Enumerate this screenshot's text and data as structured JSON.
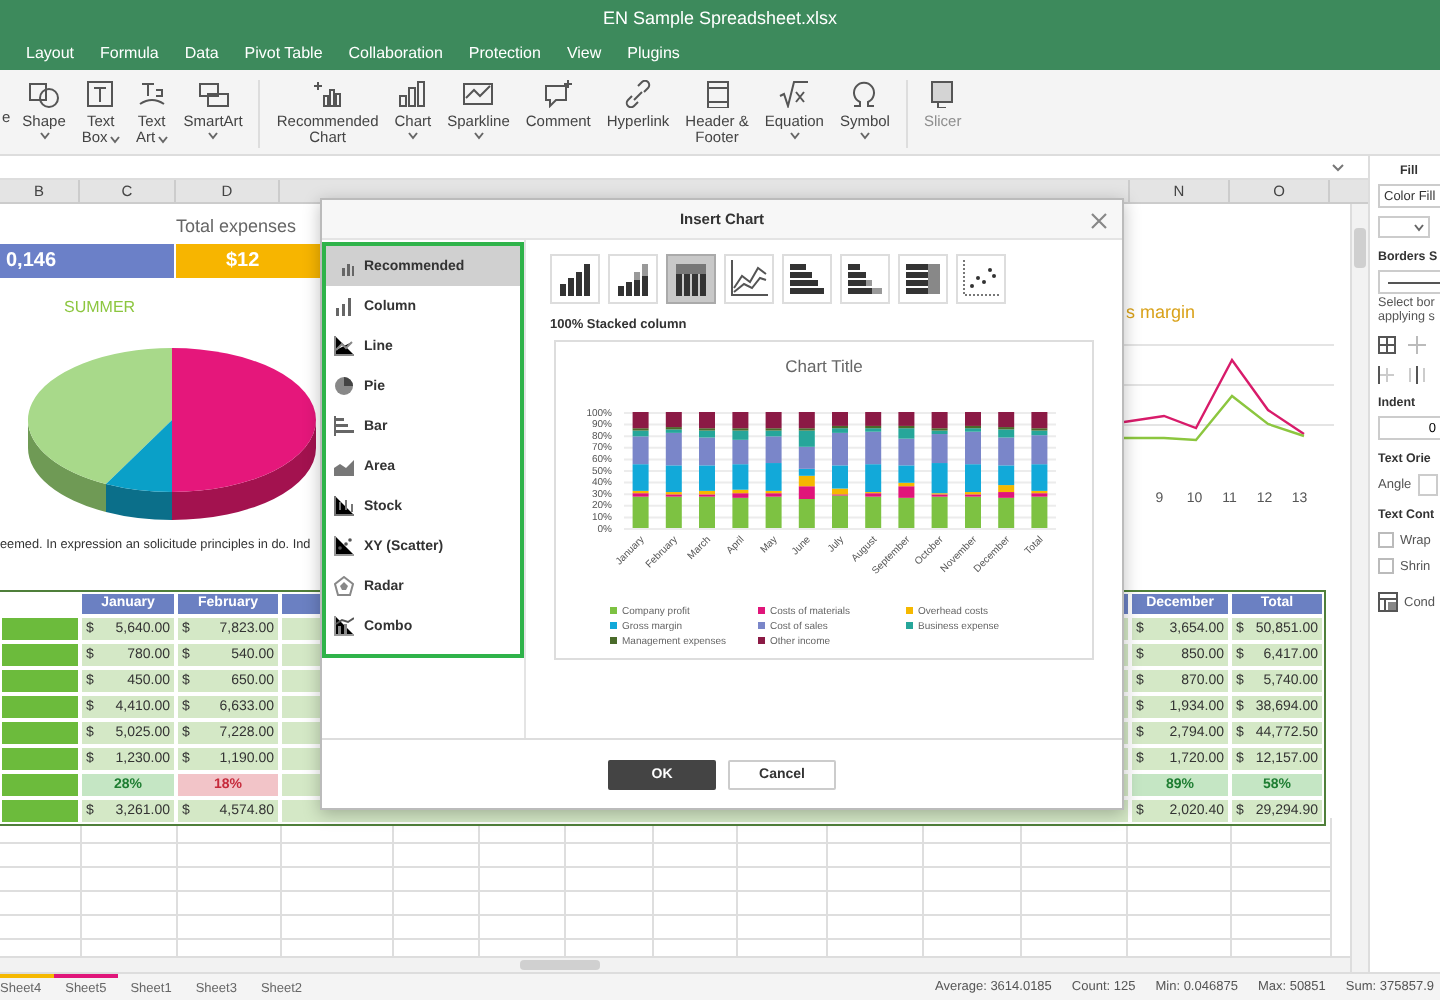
{
  "window": {
    "title": "EN Sample Spreadsheet.xlsx"
  },
  "menu_tabs": [
    {
      "label": "Layout"
    },
    {
      "label": "Formula"
    },
    {
      "label": "Data"
    },
    {
      "label": "Pivot Table"
    },
    {
      "label": "Collaboration"
    },
    {
      "label": "Protection"
    },
    {
      "label": "View"
    },
    {
      "label": "Plugins"
    }
  ],
  "toolbar": [
    {
      "lines": [
        "e"
      ],
      "dropdown": false,
      "disabled": false
    },
    {
      "lines": [
        "Shape"
      ],
      "dropdown": true,
      "disabled": false
    },
    {
      "lines": [
        "Text",
        "Box"
      ],
      "dropdown": true,
      "disabled": false
    },
    {
      "lines": [
        "Text",
        "Art"
      ],
      "dropdown": true,
      "disabled": false
    },
    {
      "lines": [
        "SmartArt"
      ],
      "dropdown": true,
      "disabled": false
    },
    {
      "lines": [
        "Recommended",
        "Chart"
      ],
      "dropdown": false,
      "disabled": false
    },
    {
      "lines": [
        "Chart"
      ],
      "dropdown": true,
      "disabled": false
    },
    {
      "lines": [
        "Sparkline"
      ],
      "dropdown": true,
      "disabled": false
    },
    {
      "lines": [
        "Comment"
      ],
      "dropdown": false,
      "disabled": false
    },
    {
      "lines": [
        "Hyperlink"
      ],
      "dropdown": false,
      "disabled": false
    },
    {
      "lines": [
        "Header &",
        "Footer"
      ],
      "dropdown": false,
      "disabled": false
    },
    {
      "lines": [
        "Equation"
      ],
      "dropdown": true,
      "disabled": false
    },
    {
      "lines": [
        "Symbol"
      ],
      "dropdown": true,
      "disabled": false
    },
    {
      "lines": [
        "Slicer"
      ],
      "dropdown": false,
      "disabled": true
    }
  ],
  "column_headers": [
    "B",
    "C",
    "D",
    "N",
    "O"
  ],
  "sheet": {
    "banner_title": "Total expenses",
    "totals": [
      {
        "text": "0,146",
        "color": "#6b80c8"
      },
      {
        "text": "$12",
        "color": "#f7b500"
      }
    ],
    "pie_title": "SUMMER",
    "caption": "eemed. In expression an solicitude principles in do. Ind",
    "line_title": "s margin",
    "line_xticks": [
      "9",
      "10",
      "11",
      "12",
      "13"
    ],
    "table": {
      "columns": [
        "January",
        "February",
        "December",
        "Total"
      ],
      "rows": [
        {
          "kind": "money",
          "cells": [
            {
              "symbol": "$",
              "amount": "5,640.00"
            },
            {
              "symbol": "$",
              "amount": "7,823.00"
            },
            {
              "symbol": "$",
              "amount": "3,654.00"
            },
            {
              "symbol": "$",
              "amount": "50,851.00"
            }
          ]
        },
        {
          "kind": "money",
          "cells": [
            {
              "symbol": "$",
              "amount": "780.00"
            },
            {
              "symbol": "$",
              "amount": "540.00"
            },
            {
              "symbol": "$",
              "amount": "850.00"
            },
            {
              "symbol": "$",
              "amount": "6,417.00"
            }
          ]
        },
        {
          "kind": "money",
          "cells": [
            {
              "symbol": "$",
              "amount": "450.00"
            },
            {
              "symbol": "$",
              "amount": "650.00"
            },
            {
              "symbol": "$",
              "amount": "870.00"
            },
            {
              "symbol": "$",
              "amount": "5,740.00"
            }
          ]
        },
        {
          "kind": "money",
          "cells": [
            {
              "symbol": "$",
              "amount": "4,410.00"
            },
            {
              "symbol": "$",
              "amount": "6,633.00"
            },
            {
              "symbol": "$",
              "amount": "1,934.00"
            },
            {
              "symbol": "$",
              "amount": "38,694.00"
            }
          ]
        },
        {
          "kind": "money",
          "cells": [
            {
              "symbol": "$",
              "amount": "5,025.00"
            },
            {
              "symbol": "$",
              "amount": "7,228.00"
            },
            {
              "symbol": "$",
              "amount": "2,794.00"
            },
            {
              "symbol": "$",
              "amount": "44,772.50"
            }
          ]
        },
        {
          "kind": "money",
          "cells": [
            {
              "symbol": "$",
              "amount": "1,230.00"
            },
            {
              "symbol": "$",
              "amount": "1,190.00"
            },
            {
              "symbol": "$",
              "amount": "1,720.00"
            },
            {
              "symbol": "$",
              "amount": "12,157.00"
            }
          ]
        },
        {
          "kind": "percent",
          "cells": [
            {
              "text": "28%",
              "negative": false
            },
            {
              "text": "18%",
              "negative": true
            },
            {
              "text": "89%",
              "negative": false
            },
            {
              "text": "58%",
              "negative": false
            }
          ]
        },
        {
          "kind": "money",
          "cells": [
            {
              "symbol": "$",
              "amount": "3,261.00"
            },
            {
              "symbol": "$",
              "amount": "4,574.80"
            },
            {
              "symbol": "$",
              "amount": "2,020.40"
            },
            {
              "symbol": "$",
              "amount": "29,294.90"
            }
          ]
        }
      ]
    }
  },
  "dialog": {
    "title": "Insert Chart",
    "chart_types": [
      {
        "label": "Recommended",
        "selected": true
      },
      {
        "label": "Column",
        "selected": false
      },
      {
        "label": "Line",
        "selected": false
      },
      {
        "label": "Pie",
        "selected": false
      },
      {
        "label": "Bar",
        "selected": false
      },
      {
        "label": "Area",
        "selected": false
      },
      {
        "label": "Stock",
        "selected": false
      },
      {
        "label": "XY (Scatter)",
        "selected": false
      },
      {
        "label": "Radar",
        "selected": false
      },
      {
        "label": "Combo",
        "selected": false
      }
    ],
    "subtypes": [
      {
        "selected": false
      },
      {
        "selected": false
      },
      {
        "selected": true
      },
      {
        "selected": false
      },
      {
        "selected": false
      },
      {
        "selected": false
      },
      {
        "selected": false
      },
      {
        "selected": false
      }
    ],
    "subtype_label": "100% Stacked column",
    "preview": {
      "chart_data": {
        "type": "bar",
        "title": "Chart Title",
        "stacked": true,
        "orientation": "vertical",
        "grid": true,
        "legend": true,
        "ylim": [
          0,
          100
        ],
        "yticks": [
          {
            "value": 0,
            "label": "0%"
          },
          {
            "value": 10,
            "label": "10%"
          },
          {
            "value": 20,
            "label": "20%"
          },
          {
            "value": 30,
            "label": "30%"
          },
          {
            "value": 40,
            "label": "40%"
          },
          {
            "value": 50,
            "label": "50%"
          },
          {
            "value": 60,
            "label": "60%"
          },
          {
            "value": 70,
            "label": "70%"
          },
          {
            "value": 80,
            "label": "80%"
          },
          {
            "value": 90,
            "label": "90%"
          },
          {
            "value": 100,
            "label": "100%"
          }
        ],
        "categories": [
          "January",
          "February",
          "March",
          "April",
          "May",
          "June",
          "July",
          "August",
          "September",
          "October",
          "November",
          "December",
          "Total"
        ],
        "series": [
          {
            "name": "Company profit",
            "color": "#7dc242",
            "values": [
              27,
              27,
              27,
              26,
              27,
              25,
              28,
              27,
              26,
              27,
              27,
              26,
              27
            ]
          },
          {
            "name": "Costs of materials",
            "color": "#e0157a",
            "values": [
              3,
              2,
              2,
              4,
              3,
              11,
              1,
              3,
              10,
              2,
              2,
              5,
              3
            ]
          },
          {
            "name": "Overhead costs",
            "color": "#f5b800",
            "values": [
              2,
              2,
              3,
              3,
              2,
              9,
              5,
              1,
              3,
              1,
              2,
              6,
              2
            ]
          },
          {
            "name": "Gross margin",
            "color": "#12a9d9",
            "values": [
              23,
              23,
              22,
              22,
              24,
              6,
              20,
              24,
              15,
              26,
              24,
              17,
              23
            ]
          },
          {
            "name": "Cost of sales",
            "color": "#7a86c9",
            "values": [
              24,
              28,
              24,
              21,
              23,
              19,
              28,
              28,
              23,
              25,
              28,
              24,
              25
            ]
          },
          {
            "name": "Business expense",
            "color": "#26a69a",
            "values": [
              5,
              3,
              6,
              8,
              5,
              14,
              4,
              3,
              9,
              3,
              3,
              7,
              4
            ]
          },
          {
            "name": "Management expenses",
            "color": "#4a6b2a",
            "values": [
              2,
              2,
              2,
              2,
              2,
              2,
              2,
              2,
              2,
              2,
              2,
              2,
              2
            ]
          },
          {
            "name": "Other income",
            "color": "#8b1a45",
            "values": [
              14,
              13,
              14,
              14,
              14,
              14,
              12,
              12,
              12,
              14,
              12,
              13,
              14
            ]
          }
        ]
      }
    },
    "buttons": [
      {
        "label": "OK",
        "kind": "primary"
      },
      {
        "label": "Cancel",
        "kind": "secondary"
      }
    ]
  },
  "format_panel": {
    "fill_title": "Fill",
    "fill_type": "Color Fill",
    "borders_title": "Borders S",
    "borders_hint": [
      "Select bor",
      "applying s"
    ],
    "indent_title": "Indent",
    "indent_value": "0",
    "orientation_title": "Text Orie",
    "angle_label": "Angle",
    "control_title": "Text Cont",
    "options": [
      {
        "label": "Wrap",
        "checked": false
      },
      {
        "label": "Shrin",
        "checked": false
      }
    ],
    "conditional": "Cond"
  },
  "sheet_tabs": [
    {
      "label": "Sheet4",
      "color": "#f5b800"
    },
    {
      "label": "Sheet5",
      "color": "#e0157a"
    },
    {
      "label": "Sheet1"
    },
    {
      "label": "Sheet3"
    },
    {
      "label": "Sheet2"
    }
  ],
  "status_bar": [
    "Average: 3614.0185",
    "Count: 125",
    "Min: 0.046875",
    "Max: 50851",
    "Sum: 375857.9"
  ]
}
